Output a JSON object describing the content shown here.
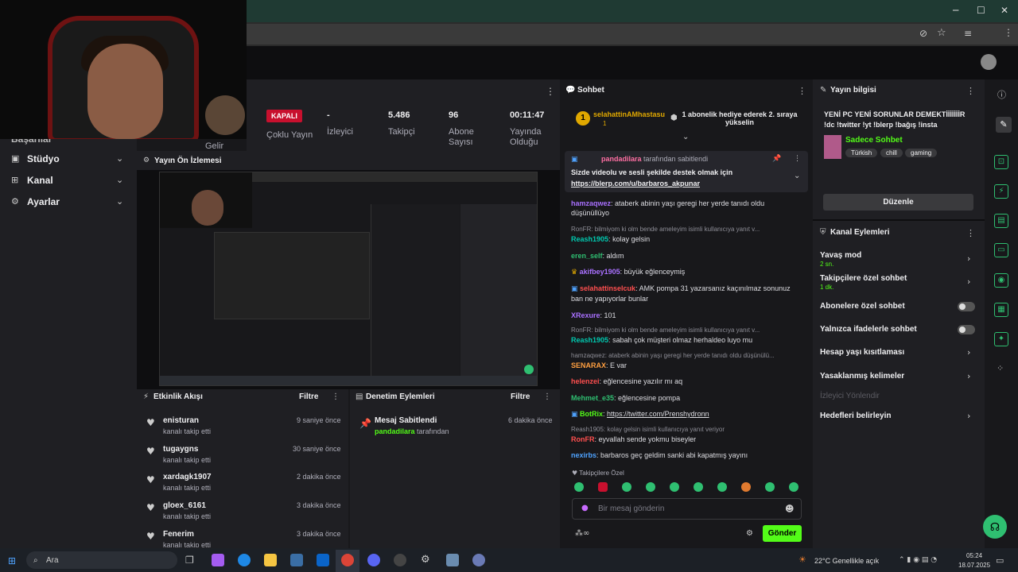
{
  "stream": {
    "status_badge": "KAPALI",
    "multistream_label": "Çoklu Yayın",
    "viewers_value": "-",
    "viewers_label": "İzleyici",
    "followers_value": "5.486",
    "followers_label": "Takipçi",
    "subs_value": "96",
    "subs_label": "Abone Sayısı",
    "duration_value": "00:11:47",
    "duration_label": "Yayında Olduğu",
    "gelir_label": "Gelir"
  },
  "nav": {
    "partial": "Başarılar",
    "items": [
      {
        "label": "Stüdyo"
      },
      {
        "label": "Kanal"
      },
      {
        "label": "Ayarlar"
      }
    ]
  },
  "preview": {
    "title": "Yayın Ön İzlemesi"
  },
  "activity": {
    "title": "Etkinlik Akışı",
    "filter": "Filtre",
    "events": [
      {
        "name": "enisturan",
        "sub": "kanalı takip etti",
        "time": "9 saniye önce"
      },
      {
        "name": "tugaygns",
        "sub": "kanalı takip etti",
        "time": "30 saniye önce"
      },
      {
        "name": "xardagk1907",
        "sub": "kanalı takip etti",
        "time": "2 dakika önce"
      },
      {
        "name": "gloex_6161",
        "sub": "kanalı takip etti",
        "time": "3 dakika önce"
      },
      {
        "name": "Fenerim",
        "sub": "kanalı takip etti",
        "time": "3 dakika önce"
      }
    ]
  },
  "moderation": {
    "title": "Denetim Eylemleri",
    "filter": "Filtre",
    "item_title": "Mesaj Sabitlendi",
    "item_user": "pandadilara",
    "item_suffix": "tarafından",
    "item_time": "6 dakika önce"
  },
  "chat": {
    "title": "Sohbet",
    "gift_user": "selahattinAMhastasu",
    "gift_count": "1",
    "gift_text": "1 abonelik hediye ederek 2. sıraya yükselin",
    "pinned_by_user": "pandadilara",
    "pinned_by_suffix": "tarafından sabitlendi",
    "pinned_text": "Sizde videolu ve sesli şekilde destek olmak için",
    "pinned_link": "https://blerp.com/u/barbaros_akpunar",
    "messages": [
      {
        "user": "hamzaqwez",
        "color": "#a970ff",
        "text": "ataberk abinin yaşı geregi her yerde tanıdı oldu düşünüllüyo"
      },
      {
        "reply": "RonFR: bilmiyom ki olm bende ameleyim isimli kullanıcıya yanıt v..."
      },
      {
        "user": "Reash1905",
        "color": "#00c8af",
        "text": "kolay gelsin"
      },
      {
        "user": "eren_self",
        "color": "#2fbf71",
        "text": "aldım"
      },
      {
        "user": "akifbey1905",
        "color": "#a970ff",
        "text": "büyük eğlenceymiş"
      },
      {
        "user": "selahattinselcuk",
        "color": "#ff4f4f",
        "text": "AMK pompa 31 yazarsanız kaçınılmaz sonunuz ban ne yapıyorlar bunlar"
      },
      {
        "user": "XRexure",
        "color": "#a970ff",
        "text": "101"
      },
      {
        "reply": "RonFR: bilmiyom ki olm bende ameleyim isimli kullanıcıya yanıt v..."
      },
      {
        "user": "Reash1905",
        "color": "#00c8af",
        "text": "sabah çok müşteri olmaz herhaldeo luyo mu"
      },
      {
        "reply": "hamzaqwez: ataberk abinin yaşı geregi her yerde tanıdı oldu düşünülü..."
      },
      {
        "user": "SENARAX",
        "color": "#ff9f40",
        "text": "E var"
      },
      {
        "user": "helenzei",
        "color": "#ff4f4f",
        "text": "eğlencesine yazılır mı aq"
      },
      {
        "user": "Mehmet_e35",
        "color": "#2fbf71",
        "text": "eğlencesine pompa"
      },
      {
        "user": "BotRix",
        "color": "#53fc18",
        "text": "https://twitter.com/Prenshydronn"
      },
      {
        "reply": "Reash1905: kolay gelsin isimli kullanıcıya yanıt veriyor"
      },
      {
        "user": "RonFR",
        "color": "#ff4f4f",
        "text": "eyvallah sende yokmu biseyler"
      },
      {
        "user": "nexirbs",
        "color": "#4fa3ff",
        "text": "barbaros geç geldim sanki abi kapatmış yayını"
      }
    ],
    "follower_label": "Takipçilere Özel",
    "input_placeholder": "Bir mesaj gönderin",
    "send_label": "Gönder"
  },
  "info": {
    "title": "Yayın bilgisi",
    "stream_title": "YENİ PC YENİ SORUNLAR DEMEKTİİİİİİİR !dc !twitter !yt !blerp !bağış !insta",
    "category": "Sadece Sohbet",
    "tags": [
      "Türkish",
      "chill",
      "gaming"
    ],
    "edit_label": "Düzenle"
  },
  "channel_actions": {
    "title": "Kanal Eylemleri",
    "items": [
      {
        "label": "Yavaş mod",
        "sub": "2 sn.",
        "kind": "chevron"
      },
      {
        "label": "Takipçilere özel sohbet",
        "sub": "1 dk.",
        "kind": "chevron"
      },
      {
        "label": "Abonelere özel sohbet",
        "sub": "",
        "kind": "toggle"
      },
      {
        "label": "Yalnızca ifadelerle sohbet",
        "sub": "",
        "kind": "toggle"
      },
      {
        "label": "Hesap yaşı kısıtlaması",
        "sub": "",
        "kind": "chevron"
      },
      {
        "label": "Yasaklanmış kelimeler",
        "sub": "",
        "kind": "chevron"
      },
      {
        "label": "İzleyici Yönlendir",
        "sub": "",
        "kind": "disabled"
      },
      {
        "label": "Hedefleri belirleyin",
        "sub": "",
        "kind": "chevron"
      }
    ]
  },
  "taskbar": {
    "search_placeholder": "Ara",
    "weather": "22°C Genellikle açık",
    "time": "05:24",
    "date": "18.07.2025"
  },
  "colors": {
    "accent": "#53fc18",
    "live_red": "#c8102e",
    "panel": "#1f1f23"
  }
}
